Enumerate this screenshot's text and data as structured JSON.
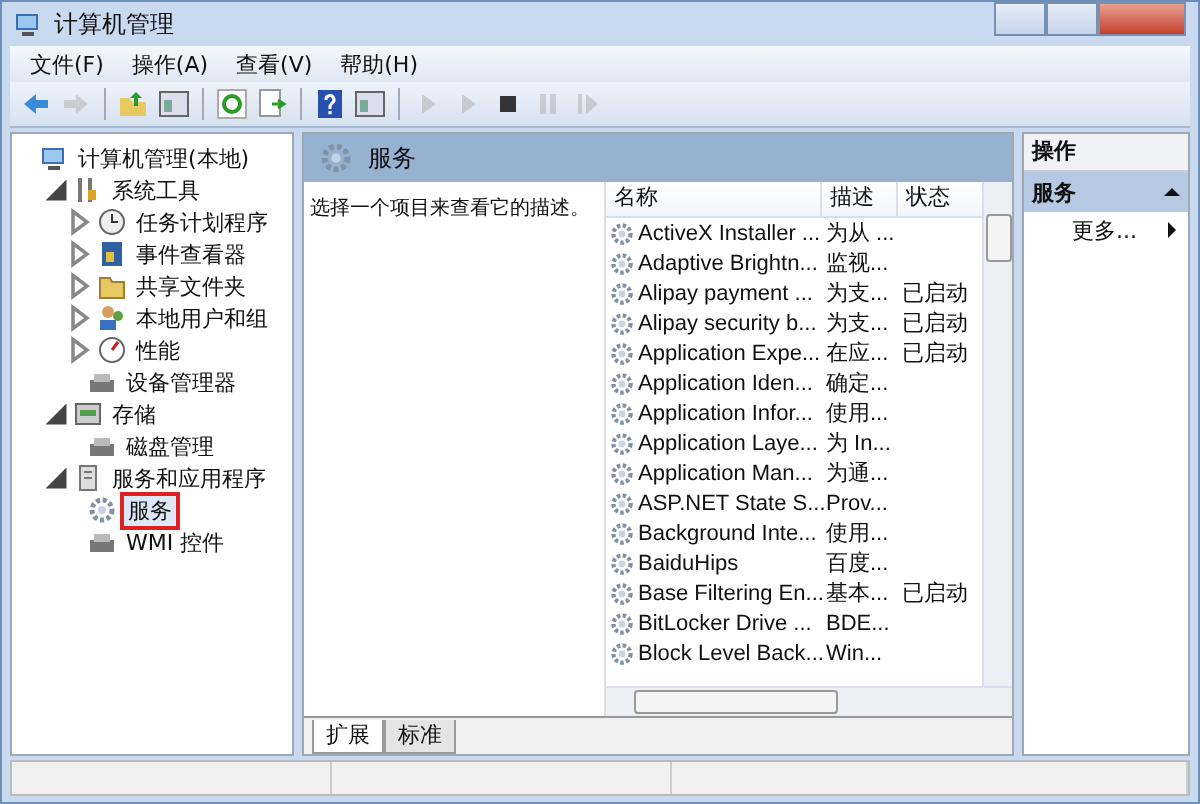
{
  "window": {
    "title": "计算机管理"
  },
  "menu": [
    "文件(F)",
    "操作(A)",
    "查看(V)",
    "帮助(H)"
  ],
  "toolbar": [
    {
      "kind": "back",
      "disabled": false
    },
    {
      "kind": "forward",
      "disabled": true
    },
    {
      "kind": "sep"
    },
    {
      "kind": "up",
      "disabled": false
    },
    {
      "kind": "pane",
      "disabled": false
    },
    {
      "kind": "sep"
    },
    {
      "kind": "refresh",
      "disabled": false
    },
    {
      "kind": "export",
      "disabled": false
    },
    {
      "kind": "sep"
    },
    {
      "kind": "help",
      "disabled": false
    },
    {
      "kind": "pane",
      "disabled": false
    },
    {
      "kind": "sep"
    },
    {
      "kind": "play",
      "disabled": true
    },
    {
      "kind": "play",
      "disabled": true
    },
    {
      "kind": "stop",
      "disabled": false
    },
    {
      "kind": "pause",
      "disabled": true
    },
    {
      "kind": "resume",
      "disabled": true
    }
  ],
  "tree": [
    {
      "label": "计算机管理(本地)",
      "kind": "computer",
      "selected": false,
      "children": [
        {
          "label": "系统工具",
          "kind": "tools",
          "expanded": true,
          "selected": false,
          "children": [
            {
              "label": "任务计划程序",
              "kind": "clock",
              "expanded": false,
              "selected": false
            },
            {
              "label": "事件查看器",
              "kind": "log",
              "expanded": false,
              "selected": false
            },
            {
              "label": "共享文件夹",
              "kind": "folder",
              "expanded": false,
              "selected": false
            },
            {
              "label": "本地用户和组",
              "kind": "users",
              "expanded": false,
              "selected": false
            },
            {
              "label": "性能",
              "kind": "gauge",
              "expanded": false,
              "selected": false
            },
            {
              "label": "设备管理器",
              "kind": "device",
              "selected": false
            }
          ]
        },
        {
          "label": "存储",
          "kind": "storage",
          "expanded": true,
          "selected": false,
          "children": [
            {
              "label": "磁盘管理",
              "kind": "device",
              "selected": false
            }
          ]
        },
        {
          "label": "服务和应用程序",
          "kind": "server",
          "expanded": true,
          "selected": false,
          "children": [
            {
              "label": "服务",
              "kind": "gear",
              "selected": true
            },
            {
              "label": "WMI 控件",
              "kind": "device",
              "selected": false
            }
          ]
        }
      ]
    }
  ],
  "main": {
    "title": "服务",
    "description": "选择一个项目来查看它的描述。",
    "columns": [
      "名称",
      "描述",
      "状态"
    ],
    "rows": [
      [
        "ActiveX Installer ...",
        "为从 ...",
        ""
      ],
      [
        "Adaptive Brightn...",
        "监视...",
        ""
      ],
      [
        "Alipay payment ...",
        "为支...",
        "已启动"
      ],
      [
        "Alipay security b...",
        "为支...",
        "已启动"
      ],
      [
        "Application Expe...",
        "在应...",
        "已启动"
      ],
      [
        "Application Iden...",
        "确定...",
        ""
      ],
      [
        "Application Infor...",
        "使用...",
        ""
      ],
      [
        "Application Laye...",
        "为 In...",
        ""
      ],
      [
        "Application Man...",
        "为通...",
        ""
      ],
      [
        "ASP.NET State S...",
        "Prov...",
        ""
      ],
      [
        "Background Inte...",
        "使用...",
        ""
      ],
      [
        "BaiduHips",
        "百度...",
        ""
      ],
      [
        "Base Filtering En...",
        "基本...",
        "已启动"
      ],
      [
        "BitLocker Drive ...",
        "BDE...",
        ""
      ],
      [
        "Block Level Back...",
        "Win...",
        ""
      ]
    ],
    "tabs": [
      {
        "label": "扩展",
        "selected": true
      },
      {
        "label": "标准",
        "selected": false
      }
    ]
  },
  "actions": {
    "title": "操作",
    "section": "服务",
    "items": [
      "更多..."
    ]
  }
}
